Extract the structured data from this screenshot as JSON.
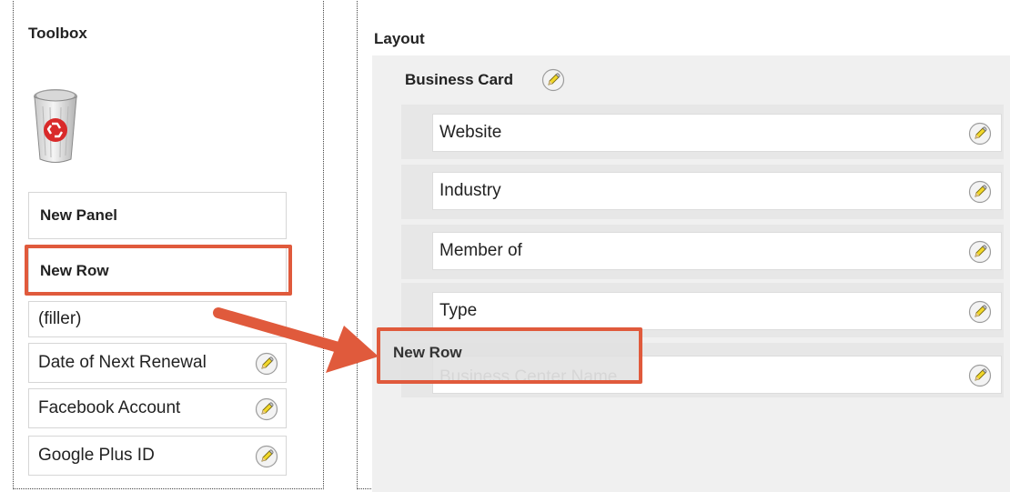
{
  "toolbox": {
    "title": "Toolbox",
    "trash_icon": "recycle-bin-icon",
    "items": [
      {
        "label": "New Panel"
      },
      {
        "label": "New Row"
      },
      {
        "label": "(filler)"
      },
      {
        "label": "Date of Next Renewal"
      },
      {
        "label": "Facebook Account"
      },
      {
        "label": "Google Plus ID"
      }
    ]
  },
  "layout": {
    "title": "Layout",
    "panel": {
      "title": "Business Card",
      "fields": [
        {
          "label": "Website"
        },
        {
          "label": "Industry"
        },
        {
          "label": "Member of"
        },
        {
          "label": "Type"
        },
        {
          "label": "Business Center Name"
        }
      ]
    }
  },
  "drag_ghost": {
    "label": "New Row"
  },
  "colors": {
    "highlight": "#e05a3c",
    "arrow": "#e05a3c",
    "layout_bg": "#f0f0f0"
  },
  "icons": {
    "edit": "pencil-icon"
  }
}
